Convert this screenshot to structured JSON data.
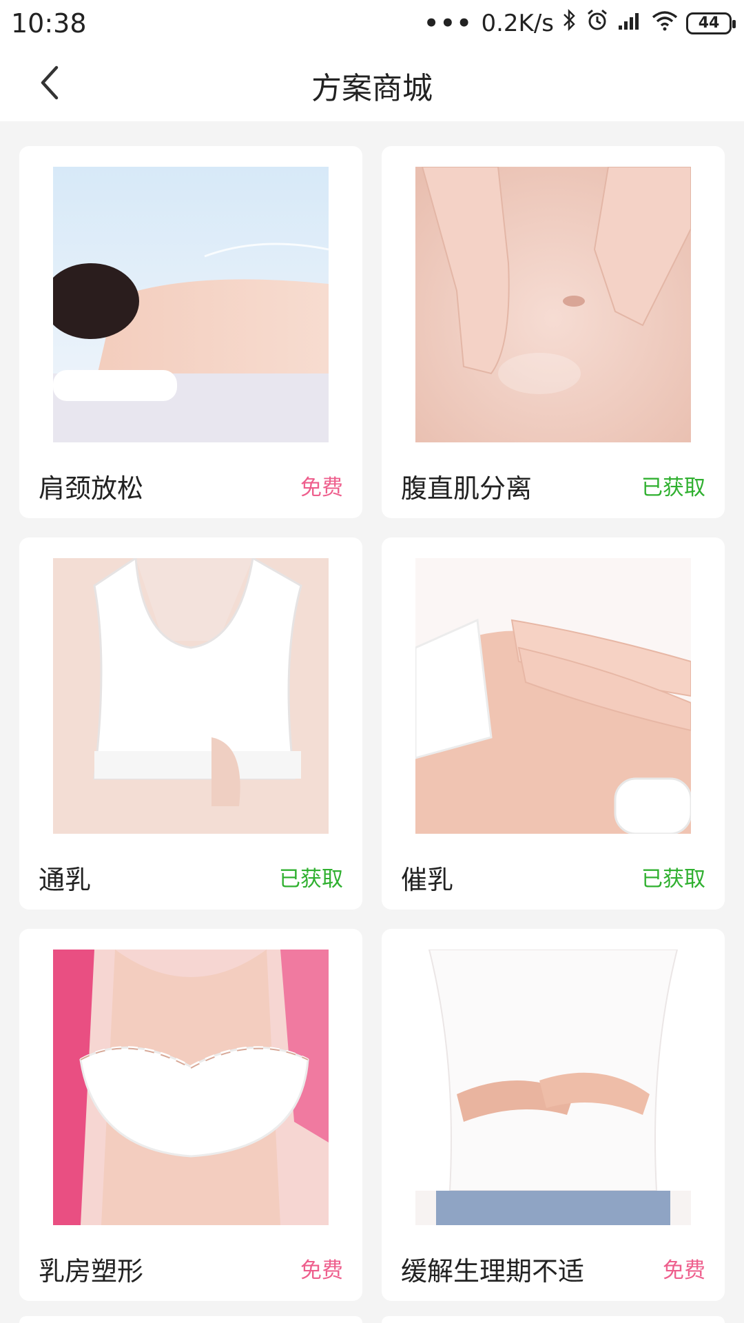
{
  "status_bar": {
    "time": "10:38",
    "dots": "•••",
    "network_speed": "0.2K/s",
    "battery": "44",
    "icons": [
      "bluetooth-icon",
      "alarm-icon",
      "signal-icon",
      "wifi-icon",
      "battery-icon"
    ]
  },
  "header": {
    "title": "方案商城",
    "back_icon": "chevron-left-icon"
  },
  "colors": {
    "free": "#ee5f8d",
    "owned": "#30b030",
    "text": "#222222",
    "background": "#f4f4f4"
  },
  "plans": [
    {
      "name": "肩颈放松",
      "badge": "免费",
      "status": "free",
      "image": "shoulder-massage"
    },
    {
      "name": "腹直肌分离",
      "badge": "已获取",
      "status": "owned",
      "image": "abdomen-massage"
    },
    {
      "name": "通乳",
      "badge": "已获取",
      "status": "owned",
      "image": "chest-care"
    },
    {
      "name": "催乳",
      "badge": "已获取",
      "status": "owned",
      "image": "belly-massage"
    },
    {
      "name": "乳房塑形",
      "badge": "免费",
      "status": "free",
      "image": "breast-shaping"
    },
    {
      "name": "缓解生理期不适",
      "badge": "免费",
      "status": "free",
      "image": "period-relief"
    }
  ]
}
